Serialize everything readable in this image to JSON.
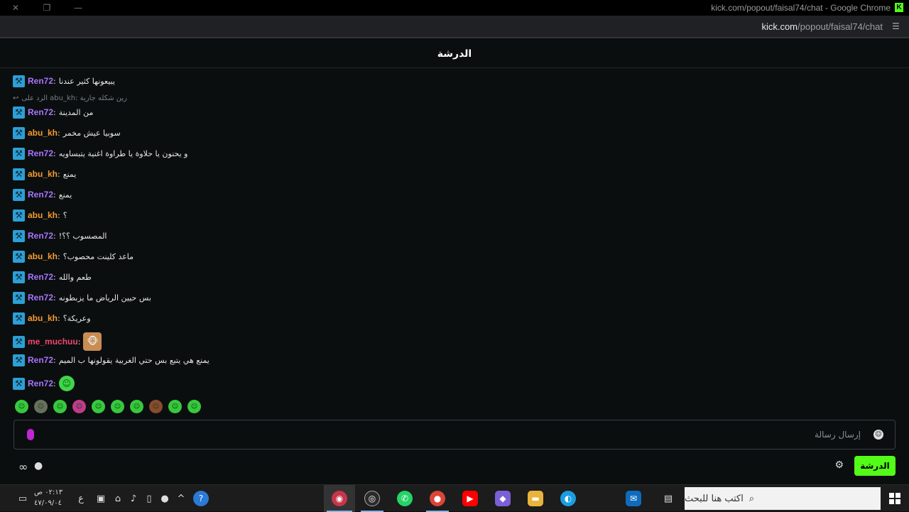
{
  "window": {
    "title": "kick.com/popout/faisal74/chat - Google Chrome",
    "kick_letter": "K"
  },
  "address": {
    "host": "kick.com",
    "path": "/popout/faisal74/chat"
  },
  "chat": {
    "header": "الدرشة",
    "reply": {
      "prefix": "الرد على",
      "user": "abu_kh",
      "text": ": رين شكله جارية"
    },
    "messages": [
      {
        "user": "Ren72",
        "color": "#a974ff",
        "text": "يبيعونها كثير عندنا"
      },
      {
        "user": "Ren72",
        "color": "#a974ff",
        "text": "من المدينة"
      },
      {
        "user": "abu_kh",
        "color": "#f59b2e",
        "text": "سوبيا عيش مخمر"
      },
      {
        "user": "Ren72",
        "color": "#a974ff",
        "text": "و يحنون يا حلاوة يا طراوة اغنية يتبساويه"
      },
      {
        "user": "abu_kh",
        "color": "#f59b2e",
        "text": "يمنع"
      },
      {
        "user": "Ren72",
        "color": "#a974ff",
        "text": "يمنع"
      },
      {
        "user": "abu_kh",
        "color": "#f59b2e",
        "text": "؟"
      },
      {
        "user": "Ren72",
        "color": "#a974ff",
        "text": "المصسوب ؟؟!"
      },
      {
        "user": "abu_kh",
        "color": "#f59b2e",
        "text": "ماعد كلينت محصوب؟"
      },
      {
        "user": "Ren72",
        "color": "#a974ff",
        "text": "طعم والله"
      },
      {
        "user": "Ren72",
        "color": "#a974ff",
        "text": "بس حيين الرياض ما يزبطونه"
      },
      {
        "user": "abu_kh",
        "color": "#f59b2e",
        "text": "وعريكة؟"
      },
      {
        "user": "me_muchuu",
        "color": "#f0476e",
        "text": "",
        "emote": "monkey"
      },
      {
        "user": "Ren72",
        "color": "#a974ff",
        "text": "يمنع هي يتبع بس حتي الغربية يقولونها ب الميم"
      },
      {
        "user": "Ren72",
        "color": "#a974ff",
        "text": "",
        "emote": "green"
      }
    ],
    "input_placeholder": "إرسال رسالة",
    "chat_button": "الدرشة"
  },
  "taskbar": {
    "search_placeholder": "اكتب هنا للبحث",
    "time": "٠٢:١٣ ص",
    "date": "٤٧/٠٩/٠٤",
    "lang": "ع"
  },
  "colors": {
    "accent": "#53fc18",
    "badge": "#2c9fd6"
  }
}
